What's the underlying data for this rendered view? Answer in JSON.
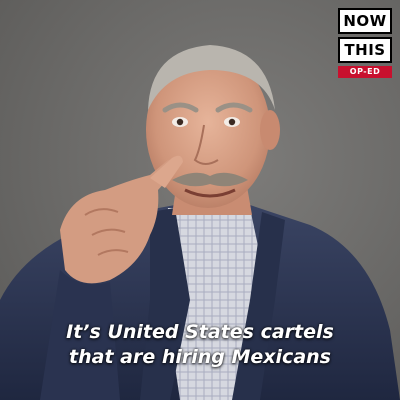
{
  "brand": {
    "line1": "NOW",
    "line2": "THIS",
    "tag": "OP-ED",
    "tag_color": "#c8102e"
  },
  "caption": {
    "line1": "It’s United States cartels",
    "line2": "that are hiring Mexicans"
  },
  "colors": {
    "background": "#6e6d6b",
    "suit": "#2c3550",
    "shirt": "#cfd2dc",
    "skin": "#d9a48a",
    "hair": "#b9b5ae"
  }
}
